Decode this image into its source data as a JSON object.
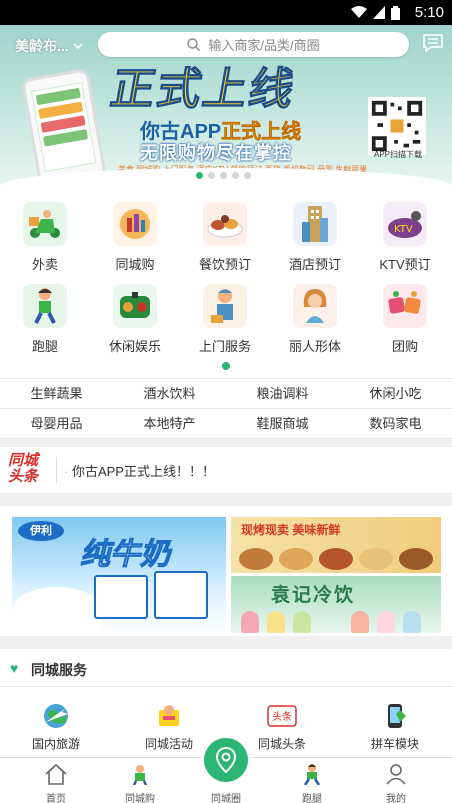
{
  "status_bar": {
    "time": "5:10"
  },
  "header": {
    "location": "美龄布...",
    "search_placeholder": "输入商家/品类/商圈"
  },
  "banner": {
    "headline": "正式上线",
    "sub_line1_prefix": "你古APP",
    "sub_line1_highlight": "正式上线",
    "sub_line2": "无限购物尽在掌控",
    "categories": "美食  同城购  上门服务  酒店KTV  餐饮预订  百货  手机数码  母婴  生鲜蔬果",
    "qr_label": "APP扫描下载",
    "dots": 5,
    "active_dot": 0
  },
  "grid": {
    "items": [
      {
        "label": "外卖",
        "icon": "scooter-icon"
      },
      {
        "label": "同城购",
        "icon": "city-shopping-icon"
      },
      {
        "label": "餐饮预订",
        "icon": "food-icon"
      },
      {
        "label": "酒店预订",
        "icon": "hotel-icon"
      },
      {
        "label": "KTV预订",
        "icon": "ktv-icon"
      },
      {
        "label": "跑腿",
        "icon": "runner-icon"
      },
      {
        "label": "休闲娱乐",
        "icon": "leisure-icon"
      },
      {
        "label": "上门服务",
        "icon": "home-service-icon"
      },
      {
        "label": "丽人形体",
        "icon": "beauty-icon"
      },
      {
        "label": "团购",
        "icon": "group-buy-icon"
      }
    ]
  },
  "categories": {
    "row1": [
      "生鲜蔬果",
      "酒水饮料",
      "粮油调料",
      "休闲小吃"
    ],
    "row2": [
      "母婴用品",
      "本地特产",
      "鞋服商城",
      "数码家电"
    ]
  },
  "ticker": {
    "logo_line1": "同城",
    "logo_line2": "头条",
    "text": "你古APP正式上线！！！"
  },
  "promo": {
    "milk_brand": "伊利",
    "milk_name": "纯牛奶",
    "snack_title": "现烤现卖  美味新鲜",
    "ice_title": "袁记冷饮"
  },
  "service": {
    "title": "同城服务",
    "items": [
      {
        "label": "国内旅游",
        "icon": "travel-icon"
      },
      {
        "label": "同城活动",
        "icon": "activity-icon"
      },
      {
        "label": "同城头条",
        "icon": "news-icon"
      },
      {
        "label": "拼车模块",
        "icon": "carpool-icon"
      }
    ]
  },
  "nav": {
    "items": [
      {
        "label": "首页",
        "icon": "home-icon"
      },
      {
        "label": "同城购",
        "icon": "city-shop-icon"
      },
      {
        "label": "同城圈",
        "icon": "location-pin-icon"
      },
      {
        "label": "跑腿",
        "icon": "runner-icon"
      },
      {
        "label": "我的",
        "icon": "user-icon"
      }
    ]
  },
  "colors": {
    "accent": "#2bb673",
    "headline_red": "#d9302a"
  }
}
